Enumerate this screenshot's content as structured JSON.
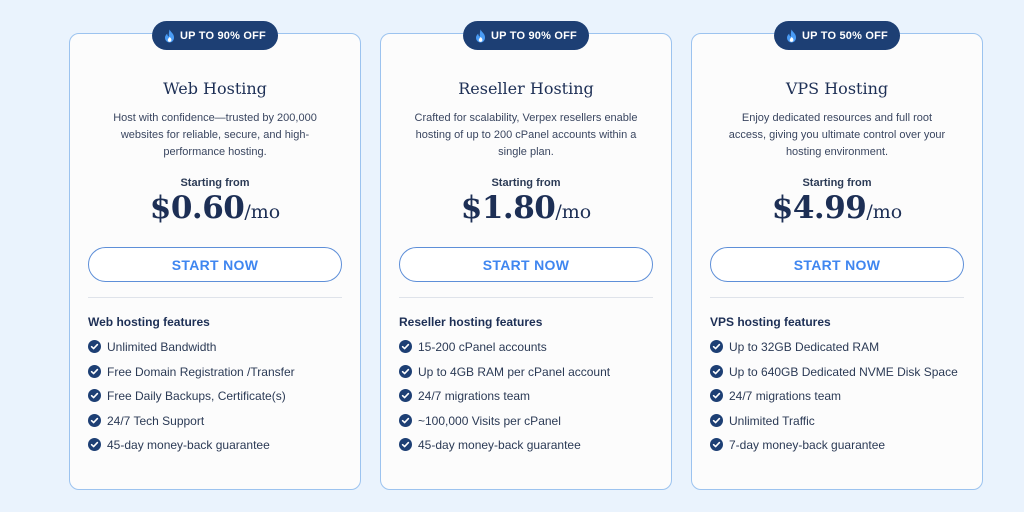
{
  "colors": {
    "background": "#eaf3fd",
    "card_border": "#9cc3ef",
    "badge_bg": "#1d3f74",
    "accent": "#3f86f0",
    "check": "#1d3f74"
  },
  "cards": [
    {
      "badge": "UP TO 90% OFF",
      "badge_icon": "flame-icon",
      "title": "Web Hosting",
      "description": "Host with confidence—trusted by 200,000 websites for reliable, secure, and high-performance hosting.",
      "starting_label": "Starting from",
      "price": "$0.60",
      "price_unit": "/mo",
      "button_label": "START NOW",
      "features_heading": "Web hosting features",
      "features": [
        "Unlimited Bandwidth",
        "Free Domain Registration /Transfer",
        "Free Daily Backups, Certificate(s)",
        "24/7 Tech Support",
        "45-day money-back guarantee"
      ]
    },
    {
      "badge": "UP TO 90% OFF",
      "badge_icon": "flame-icon",
      "title": "Reseller Hosting",
      "description": "Crafted for scalability, Verpex resellers enable hosting of up to 200 cPanel accounts within a single plan.",
      "starting_label": "Starting from",
      "price": "$1.80",
      "price_unit": "/mo",
      "button_label": "START NOW",
      "features_heading": "Reseller hosting features",
      "features": [
        "15-200 cPanel accounts",
        "Up to 4GB RAM per cPanel account",
        "24/7 migrations team",
        "~100,000 Visits per cPanel",
        "45-day money-back guarantee"
      ]
    },
    {
      "badge": "UP TO 50% OFF",
      "badge_icon": "flame-icon",
      "title": "VPS Hosting",
      "description": "Enjoy dedicated resources and full root access, giving you ultimate control over your hosting environment.",
      "starting_label": "Starting from",
      "price": "$4.99",
      "price_unit": "/mo",
      "button_label": "START NOW",
      "features_heading": "VPS hosting features",
      "features": [
        "Up to 32GB Dedicated RAM",
        "Up to 640GB Dedicated NVME Disk Space",
        "24/7 migrations team",
        "Unlimited Traffic",
        "7-day money-back guarantee"
      ]
    }
  ]
}
